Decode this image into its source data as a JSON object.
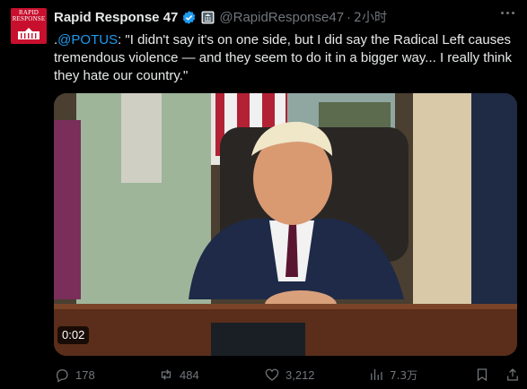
{
  "author": {
    "display_name": "Rapid Response 47",
    "handle": "@RapidResponse47",
    "separator": "·",
    "time": "2小时",
    "avatar_text": [
      "RAPID",
      "RESPONSE"
    ],
    "avatar_color": "#c8102e",
    "verified_icon": "verified-badge-icon",
    "affiliation_icon": "government-building-badge-icon"
  },
  "post": {
    "prefix": ".",
    "mention": "@POTUS",
    "text": ": \"I didn't say it's on one side, but I did say the Radical Left causes tremendous violence — and they seem to do it in a bigger way... I really think they hate our country.\""
  },
  "media": {
    "timestamp": "0:02"
  },
  "actions": {
    "replies": "178",
    "reposts": "484",
    "likes": "3,212",
    "views": "7.3万"
  },
  "colors": {
    "background": "#000000",
    "text": "#e7e9ea",
    "muted": "#71767b",
    "link": "#1d9bf0",
    "verified": "#1d9bf0"
  }
}
